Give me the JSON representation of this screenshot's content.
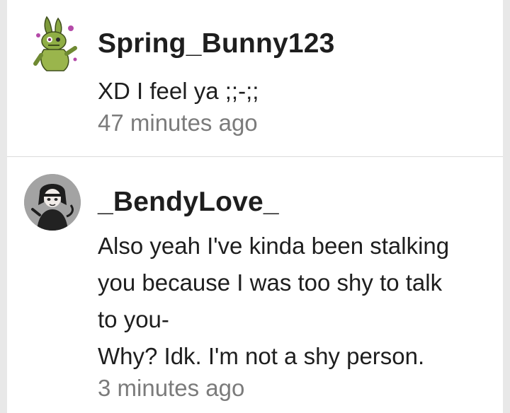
{
  "comments": [
    {
      "username": "Spring_Bunny123",
      "lines": [
        "XD I feel ya ;;-;;"
      ],
      "time": "47 minutes ago",
      "avatar_icon": "green-rabbit-character-avatar"
    },
    {
      "username": "_BendyLove_",
      "lines": [
        "Also yeah I've kinda been stalking",
        "you because I was too shy to talk",
        "to you-",
        "Why? Idk. I'm not a shy person."
      ],
      "time": "3 minutes ago",
      "avatar_icon": "dark-haired-character-avatar"
    }
  ],
  "colors": {
    "background": "#e8e8e8",
    "card": "#ffffff",
    "text": "#1e1e1e",
    "timestamp": "#7b7b7b",
    "divider": "#dcdcdc"
  }
}
